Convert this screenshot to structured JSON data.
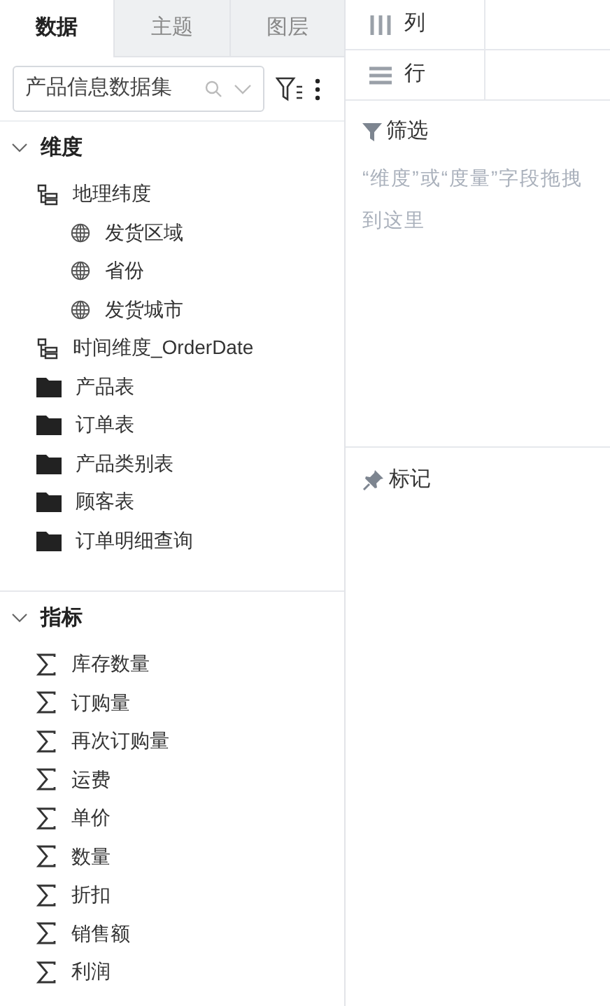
{
  "tabs": [
    {
      "label": "数据",
      "selected": true
    },
    {
      "label": "主题",
      "selected": false
    },
    {
      "label": "图层",
      "selected": false
    }
  ],
  "dataset_select": {
    "value": "产品信息数据集"
  },
  "sections": [
    {
      "title": "维度",
      "expanded": true,
      "items": [
        {
          "kind": "hierarchy",
          "label": "地理纬度",
          "children": [
            {
              "kind": "geo",
              "label": "发货区域"
            },
            {
              "kind": "geo",
              "label": "省份"
            },
            {
              "kind": "geo",
              "label": "发货城市"
            }
          ]
        },
        {
          "kind": "hierarchy",
          "label": "时间维度_OrderDate"
        },
        {
          "kind": "folder",
          "label": "产品表"
        },
        {
          "kind": "folder",
          "label": "订单表"
        },
        {
          "kind": "folder",
          "label": "产品类别表"
        },
        {
          "kind": "folder",
          "label": "顾客表"
        },
        {
          "kind": "folder",
          "label": "订单明细查询"
        }
      ]
    },
    {
      "title": "指标",
      "expanded": true,
      "items": [
        {
          "kind": "measure",
          "label": "库存数量"
        },
        {
          "kind": "measure",
          "label": "订购量"
        },
        {
          "kind": "measure",
          "label": "再次订购量"
        },
        {
          "kind": "measure",
          "label": "运费"
        },
        {
          "kind": "measure",
          "label": "单价"
        },
        {
          "kind": "measure",
          "label": "数量"
        },
        {
          "kind": "measure",
          "label": "折扣"
        },
        {
          "kind": "measure",
          "label": "销售额"
        },
        {
          "kind": "measure",
          "label": "利润"
        }
      ]
    }
  ],
  "shelves": [
    {
      "kind": "columns",
      "label": "列"
    },
    {
      "kind": "rows",
      "label": "行"
    }
  ],
  "filter": {
    "title": "筛选",
    "hint": "“维度”或“度量”字段拖拽到这里"
  },
  "marks": {
    "title": "标记"
  }
}
